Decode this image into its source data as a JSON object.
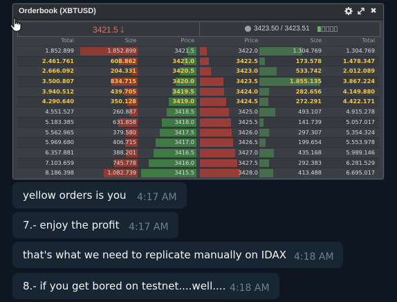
{
  "window": {
    "title": "Orderbook (XBTUSD)",
    "controls": [
      "gear-icon",
      "expand-icon",
      "close-icon"
    ],
    "close_glyph": "✖"
  },
  "summary": {
    "last_price": "3421.5",
    "direction": "down",
    "bid_ask": "3423.50 / 3423.51",
    "spread_indicator_filled": 1,
    "spread_indicator_total": 5
  },
  "table": {
    "headers": {
      "bid_total": "Total",
      "bid_size": "Size",
      "bid_price": "Price",
      "ask_price": "Price",
      "ask_size": "Size",
      "ask_total": "Total"
    },
    "bids": [
      {
        "total": "1.852.899",
        "size": "1.852.899",
        "price": "3421.5",
        "depth": 0.08,
        "size_frac": 0.97,
        "mine": false
      },
      {
        "total": "2.461.761",
        "size": "608.862",
        "price": "3421.0",
        "depth": 0.12,
        "size_frac": 0.32,
        "mine": true
      },
      {
        "total": "2.666.092",
        "size": "204.331",
        "price": "3420.5",
        "depth": 0.15,
        "size_frac": 0.11,
        "mine": true
      },
      {
        "total": "3.500.807",
        "size": "834.715",
        "price": "3420.0",
        "depth": 0.19,
        "size_frac": 0.44,
        "mine": true
      },
      {
        "total": "3.940.512",
        "size": "439.705",
        "price": "3419.5",
        "depth": 0.22,
        "size_frac": 0.23,
        "mine": true
      },
      {
        "total": "4.290.640",
        "size": "350.128",
        "price": "3419.0",
        "depth": 0.25,
        "size_frac": 0.18,
        "mine": true
      },
      {
        "total": "4.551.527",
        "size": "260.887",
        "price": "3418.5",
        "depth": 0.27,
        "size_frac": 0.14,
        "mine": false
      },
      {
        "total": "5.183.385",
        "size": "631.858",
        "price": "3418.0",
        "depth": 0.31,
        "size_frac": 0.33,
        "mine": false
      },
      {
        "total": "5.562.965",
        "size": "379.580",
        "price": "3417.5",
        "depth": 0.33,
        "size_frac": 0.2,
        "mine": false
      },
      {
        "total": "5.969.680",
        "size": "406.715",
        "price": "3417.0",
        "depth": 0.37,
        "size_frac": 0.21,
        "mine": false
      },
      {
        "total": "6.357.881",
        "size": "388.201",
        "price": "3416.5",
        "depth": 0.39,
        "size_frac": 0.2,
        "mine": false
      },
      {
        "total": "7.103.659",
        "size": "745.778",
        "price": "3416.0",
        "depth": 0.43,
        "size_frac": 0.39,
        "mine": false
      },
      {
        "total": "8.186.398",
        "size": "1.082.739",
        "price": "3415.5",
        "depth": 0.5,
        "size_frac": 0.57,
        "mine": false
      }
    ],
    "asks": [
      {
        "price": "3422.0",
        "size": "1.304.769",
        "total": "1.304.769",
        "depth": 0.06,
        "size_frac": 0.69,
        "mine": false
      },
      {
        "price": "3422.5",
        "size": "173.578",
        "total": "1.478.347",
        "depth": 0.08,
        "size_frac": 0.09,
        "mine": true
      },
      {
        "price": "3423.0",
        "size": "533.742",
        "total": "2.012.089",
        "depth": 0.1,
        "size_frac": 0.28,
        "mine": true
      },
      {
        "price": "3423.5",
        "size": "1.855.135",
        "total": "3.867.224",
        "depth": 0.21,
        "size_frac": 0.98,
        "mine": true
      },
      {
        "price": "3424.0",
        "size": "282.656",
        "total": "4.149.880",
        "depth": 0.22,
        "size_frac": 0.15,
        "mine": true
      },
      {
        "price": "3424.5",
        "size": "272.291",
        "total": "4.422.171",
        "depth": 0.24,
        "size_frac": 0.14,
        "mine": true
      },
      {
        "price": "3425.0",
        "size": "493.107",
        "total": "4.915.278",
        "depth": 0.26,
        "size_frac": 0.26,
        "mine": false
      },
      {
        "price": "3425.5",
        "size": "141.739",
        "total": "5.057.017",
        "depth": 0.28,
        "size_frac": 0.07,
        "mine": false
      },
      {
        "price": "3426.0",
        "size": "297.307",
        "total": "5.354.324",
        "depth": 0.29,
        "size_frac": 0.16,
        "mine": false
      },
      {
        "price": "3426.5",
        "size": "199.654",
        "total": "5.553.978",
        "depth": 0.3,
        "size_frac": 0.1,
        "mine": false
      },
      {
        "price": "3427.0",
        "size": "435.168",
        "total": "5.989.146",
        "depth": 0.32,
        "size_frac": 0.23,
        "mine": false
      },
      {
        "price": "3427.5",
        "size": "292.383",
        "total": "6.281.529",
        "depth": 0.34,
        "size_frac": 0.15,
        "mine": false
      },
      {
        "price": "3428.0",
        "size": "413.488",
        "total": "6.695.017",
        "depth": 0.36,
        "size_frac": 0.22,
        "mine": false
      }
    ]
  },
  "colors": {
    "own_order": "#f2c84b",
    "bid": "#3f7a45",
    "ask": "#9a3c37",
    "chat_bg": "#0e1621",
    "bubble": "#182533",
    "timestamp": "#6d8291"
  },
  "messages": [
    {
      "text": "yellow orders is you",
      "time": "4:17 AM"
    },
    {
      "text": "7.- enjoy the profit",
      "time": "4:17 AM"
    },
    {
      "text": "that's what we need to replicate manually on IDAX",
      "time": "4:18 AM"
    },
    {
      "text": "8.- if you get bored on testnet....well....",
      "time": "4:18 AM"
    }
  ]
}
